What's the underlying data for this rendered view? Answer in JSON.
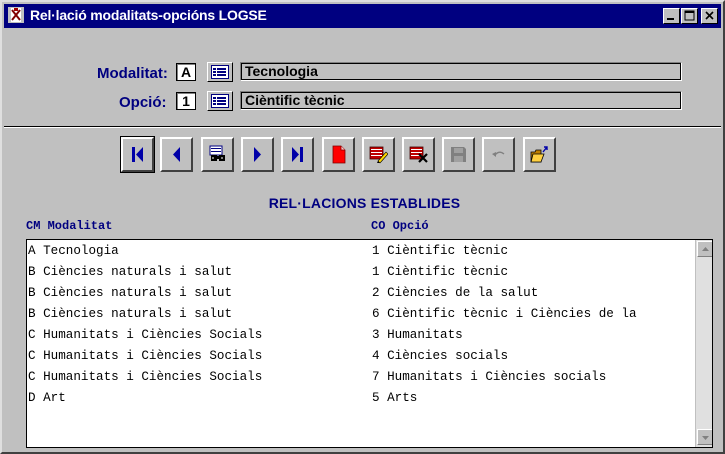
{
  "window": {
    "title": "Rel·lació modalitats-opcións LOGSE"
  },
  "form": {
    "modalitat_label": "Modalitat:",
    "modalitat_code": "A",
    "modalitat_desc": "Tecnologia",
    "opcio_label": "Opció:",
    "opcio_code": "1",
    "opcio_desc": "Cièntific tècnic"
  },
  "toolbar": {
    "icons": [
      "first-record-icon",
      "previous-record-icon",
      "find-icon",
      "next-record-icon",
      "last-record-icon",
      "new-record-icon",
      "edit-record-icon",
      "delete-record-icon",
      "save-icon",
      "undo-icon",
      "exit-icon"
    ]
  },
  "list": {
    "heading": "REL·LACIONS ESTABLIDES",
    "col1_header": "CM Modalitat",
    "col2_header": "CO Opció",
    "rows": [
      {
        "modalitat": "A Tecnologia",
        "opcio": "1 Cièntific tècnic"
      },
      {
        "modalitat": "B Ciències naturals i salut",
        "opcio": "1 Cièntific tècnic"
      },
      {
        "modalitat": "B Ciències naturals i salut",
        "opcio": "2 Ciències de la salut"
      },
      {
        "modalitat": "B Ciències naturals i salut",
        "opcio": "6 Cièntific tècnic i Ciències de la"
      },
      {
        "modalitat": "C Humanitats i Ciències Socials",
        "opcio": "3 Humanitats"
      },
      {
        "modalitat": "C Humanitats i Ciències Socials",
        "opcio": "4 Ciències socials"
      },
      {
        "modalitat": "C Humanitats i Ciències Socials",
        "opcio": "7 Humanitats i Ciències socials"
      },
      {
        "modalitat": "D Art",
        "opcio": "5 Arts"
      }
    ]
  },
  "colors": {
    "titlebar": "#000080",
    "label": "#000080",
    "nav_blue": "#0000a8",
    "red": "#ff0000"
  }
}
